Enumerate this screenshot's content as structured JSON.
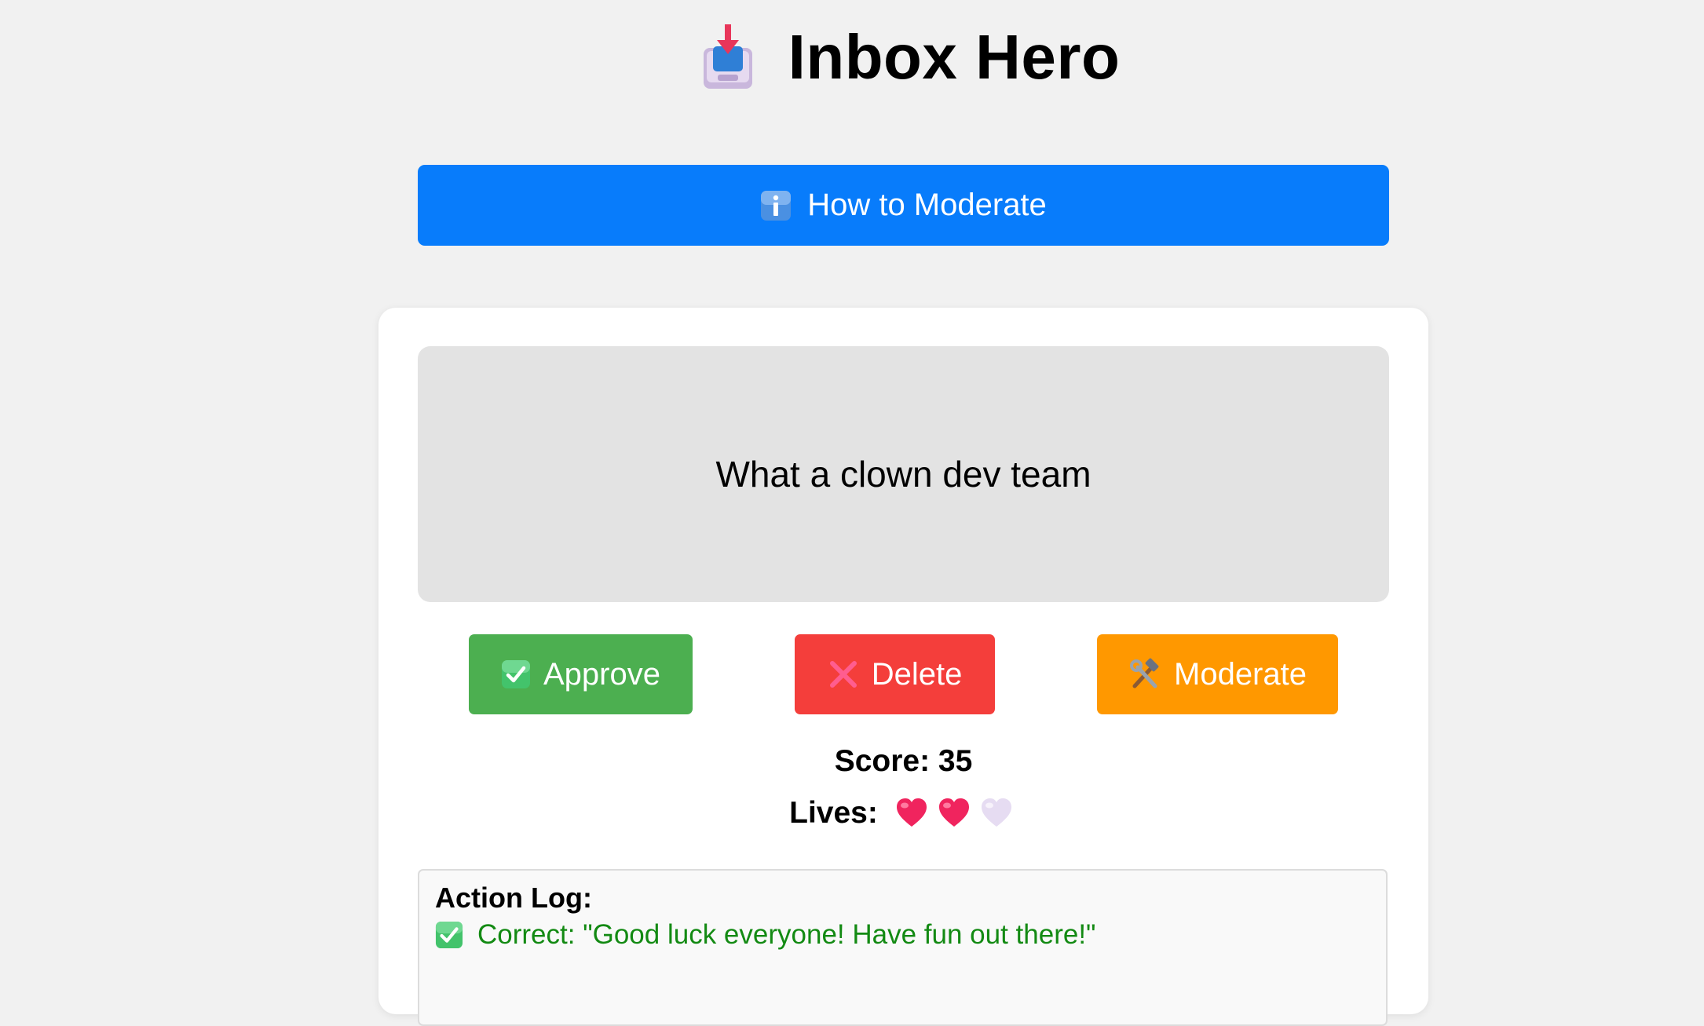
{
  "app": {
    "title": "Inbox Hero",
    "logo_icon": "inbox-tray-icon"
  },
  "help_button": {
    "label": "How to Moderate",
    "icon": "info-icon",
    "color": "#087cfb"
  },
  "message": {
    "text": "What a clown dev team"
  },
  "actions": {
    "approve": {
      "label": "Approve",
      "icon": "check-mark-icon",
      "color": "#4caf50"
    },
    "delete": {
      "label": "Delete",
      "icon": "cross-mark-icon",
      "color": "#f43e3b"
    },
    "moderate": {
      "label": "Moderate",
      "icon": "hammer-wrench-icon",
      "color": "#ff9800"
    }
  },
  "status": {
    "score_text": "Score: 35",
    "lives_label": "Lives:",
    "lives_total": 3,
    "lives_remaining": 2
  },
  "log": {
    "title": "Action Log:",
    "entries": [
      {
        "icon": "check-mark-icon",
        "text": "Correct: \"Good luck everyone! Have fun out there!\"",
        "color": "#138a13"
      }
    ]
  }
}
